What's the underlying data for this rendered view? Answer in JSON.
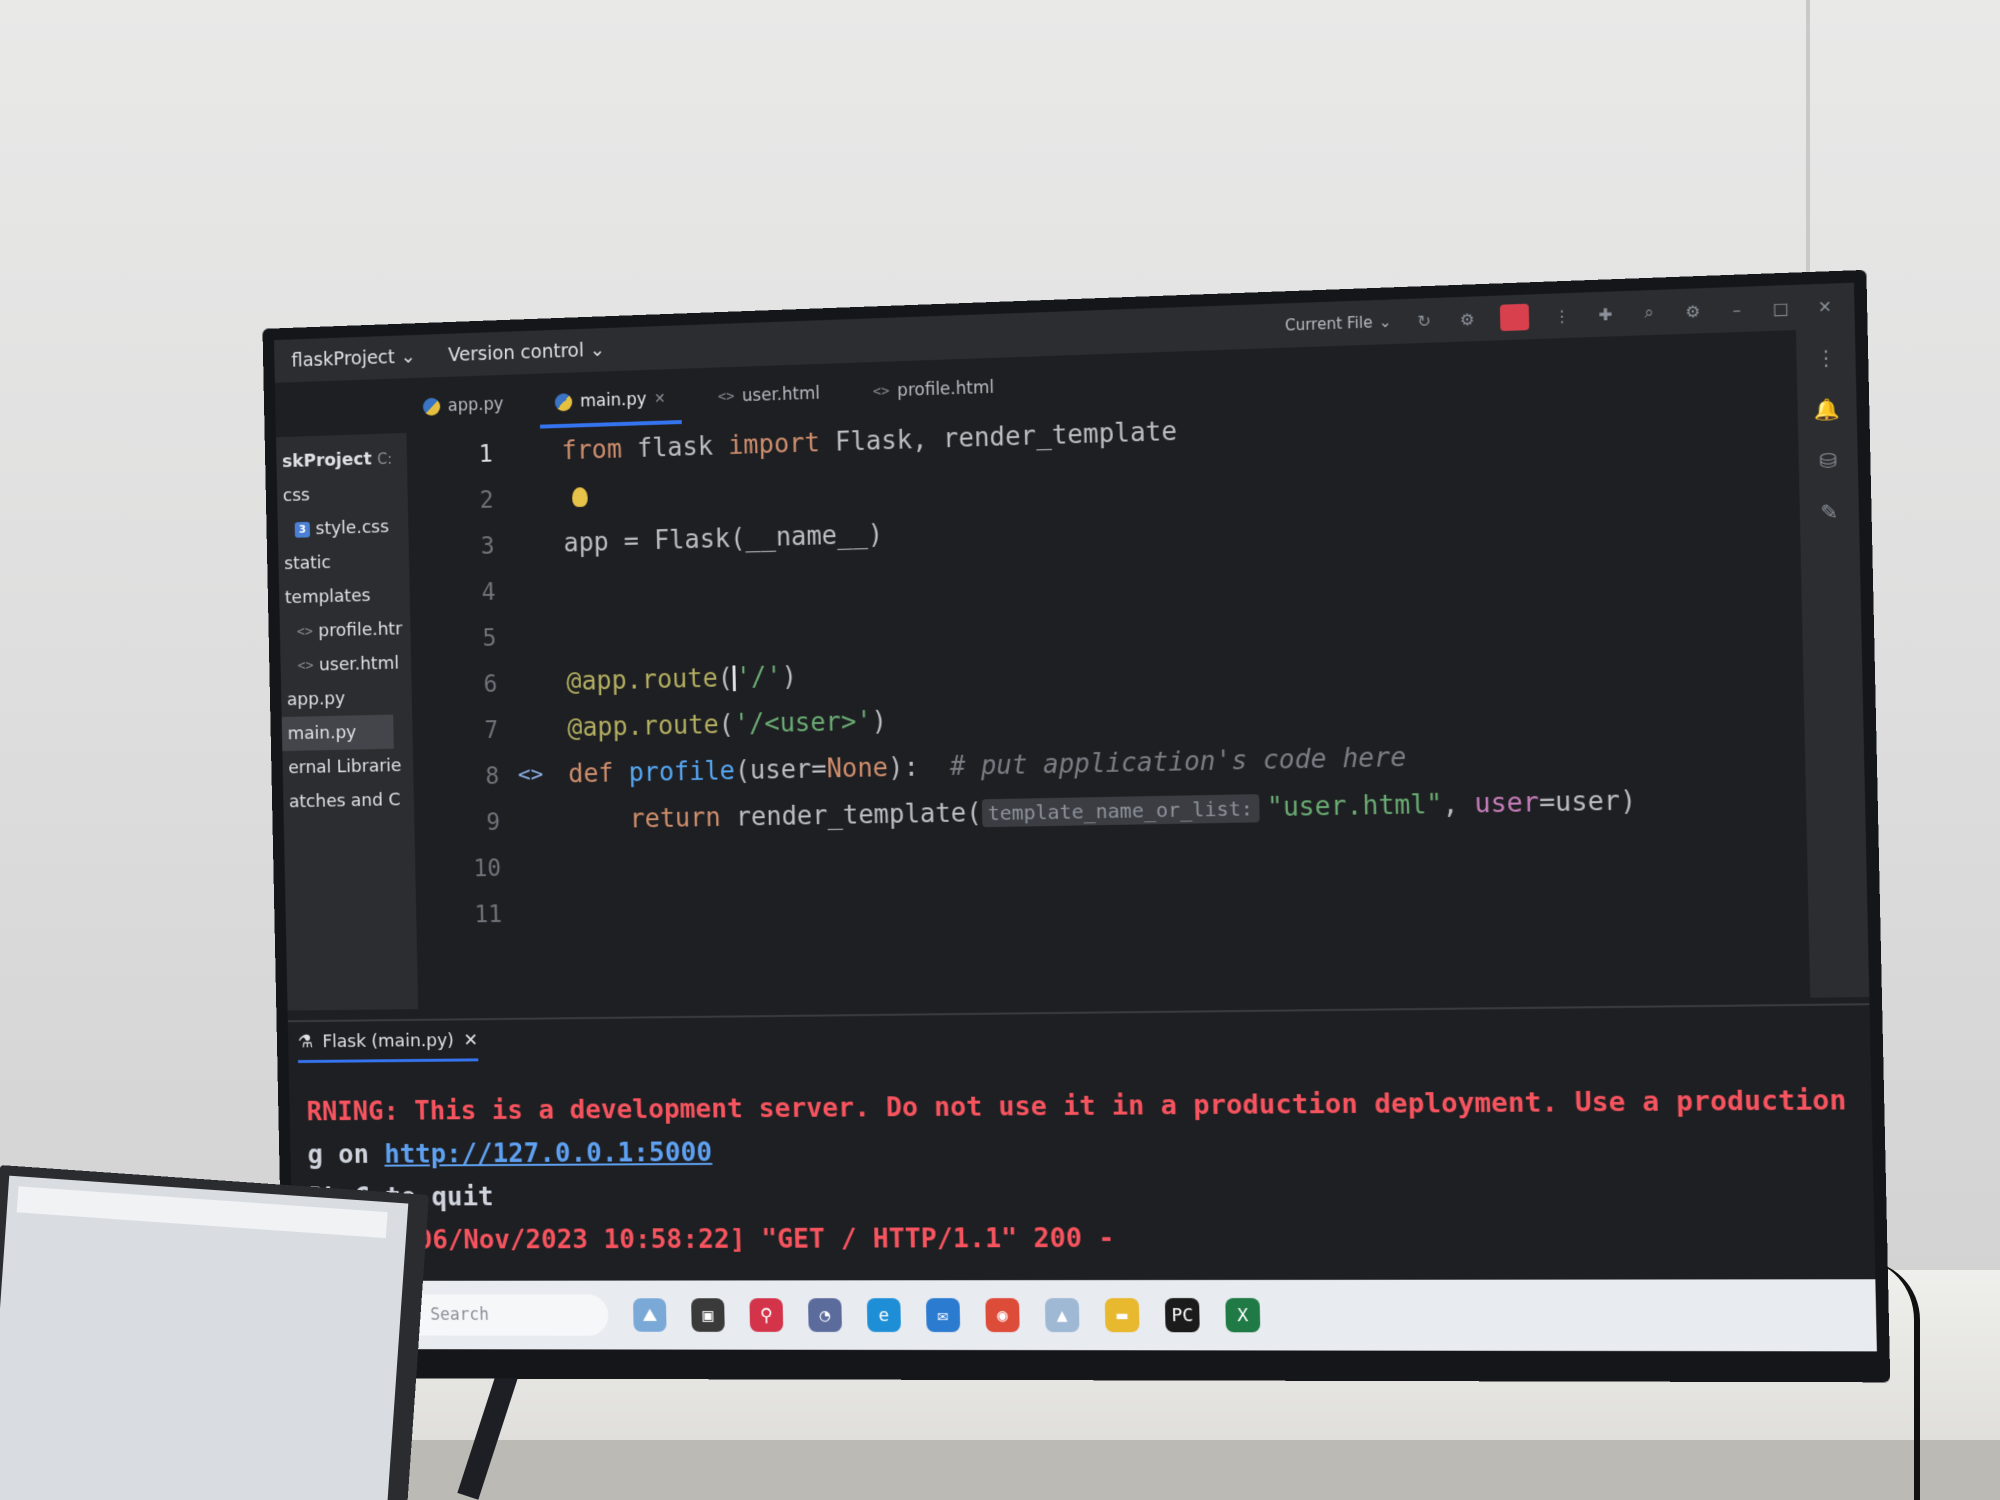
{
  "titlebar": {
    "project": "flaskProject",
    "vcs": "Version control",
    "run_config": "Current File"
  },
  "tabs": [
    {
      "label": "app.py",
      "icon": "python-icon",
      "active": false
    },
    {
      "label": "main.py",
      "icon": "python-icon",
      "active": true
    },
    {
      "label": "user.html",
      "icon": "html-icon",
      "active": false
    },
    {
      "label": "profile.html",
      "icon": "html-icon",
      "active": false
    }
  ],
  "tree": {
    "root": "skProject",
    "root_suffix": "C:",
    "items": [
      "css",
      "style.css",
      "static",
      "templates",
      "profile.htr",
      "user.html",
      "app.py",
      "main.py",
      "ernal Librarie",
      "atches and C"
    ]
  },
  "code": {
    "line_numbers": [
      "1",
      "2",
      "3",
      "4",
      "5",
      "6",
      "7",
      "8",
      "9",
      "10",
      "11"
    ],
    "l1_from": "from",
    "l1_mod": " flask ",
    "l1_import": "import",
    "l1_names": " Flask, render_template",
    "l3": "app = Flask(__name__)",
    "l6_dec": "@app.route",
    "l6_open": "(",
    "l6_str": "'/'",
    "l6_close": ")",
    "l7_dec": "@app.route",
    "l7_open": "(",
    "l7_str": "'/<user>'",
    "l7_close": ")",
    "l8_def": "def",
    "l8_fn": "profile",
    "l8_args_a": "(user=",
    "l8_none": "None",
    "l8_args_b": "):",
    "l8_comment": "# put application's code here",
    "l9_return": "return",
    "l9_call": " render_template(",
    "l9_hint": "template_name_or_list:",
    "l9_str": "\"user.html\"",
    "l9_sep": ", ",
    "l9_param": "user",
    "l9_tail": "=user)"
  },
  "run": {
    "tab_label": "Flask (main.py)",
    "line1_warn_a": "RNING: ",
    "line1_warn_b": "This is a development server. Do not use it in a production deployment. Use a production WSGI se",
    "line2_prefix": "g on ",
    "line2_url": "http://127.0.0.1:5000",
    "line3": "RL+C to quit",
    "line4": "1 - - [06/Nov/2023 10:58:22] \"GET / HTTP/1.1\" 200 -"
  },
  "taskbar": {
    "search_placeholder": "Search",
    "icons": [
      "landscape-icon",
      "file-explorer-icon",
      "pin-icon",
      "chat-icon",
      "edge-icon",
      "mail-icon",
      "chrome-icon",
      "photos-icon",
      "folder-icon",
      "pycharm-icon",
      "excel-icon"
    ]
  },
  "colors": {
    "editor_bg": "#1e1f22",
    "keyword": "#cf8e6d",
    "string": "#6aab73",
    "function": "#56a8f5",
    "warning": "#f7545f",
    "accent": "#3574f0"
  }
}
